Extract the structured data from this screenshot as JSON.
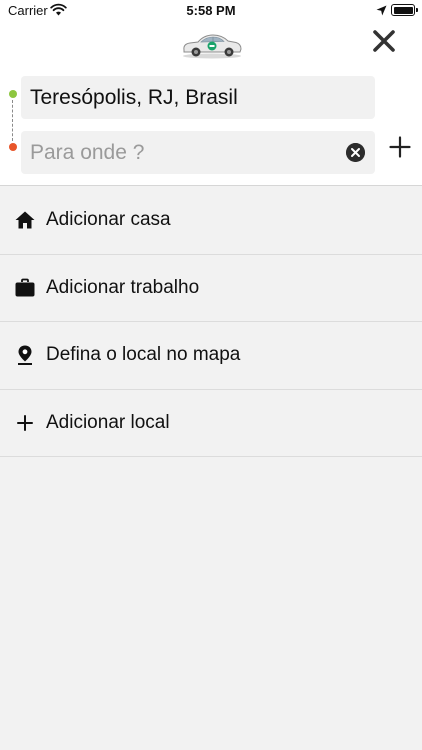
{
  "status_bar": {
    "carrier": "Carrier",
    "time": "5:58 PM"
  },
  "header": {
    "logo_icon": "car-logo-icon",
    "close_icon": "close-icon"
  },
  "route": {
    "origin_value": "Teresópolis, RJ, Brasil",
    "destination_placeholder": "Para onde ?",
    "origin_color": "#8dc63f",
    "destination_color": "#e8552a"
  },
  "shortcuts": [
    {
      "icon": "home-icon",
      "label": "Adicionar casa"
    },
    {
      "icon": "briefcase-icon",
      "label": "Adicionar trabalho"
    },
    {
      "icon": "map-pin-icon",
      "label": "Defina o local no mapa"
    },
    {
      "icon": "plus-icon",
      "label": "Adicionar local"
    }
  ]
}
